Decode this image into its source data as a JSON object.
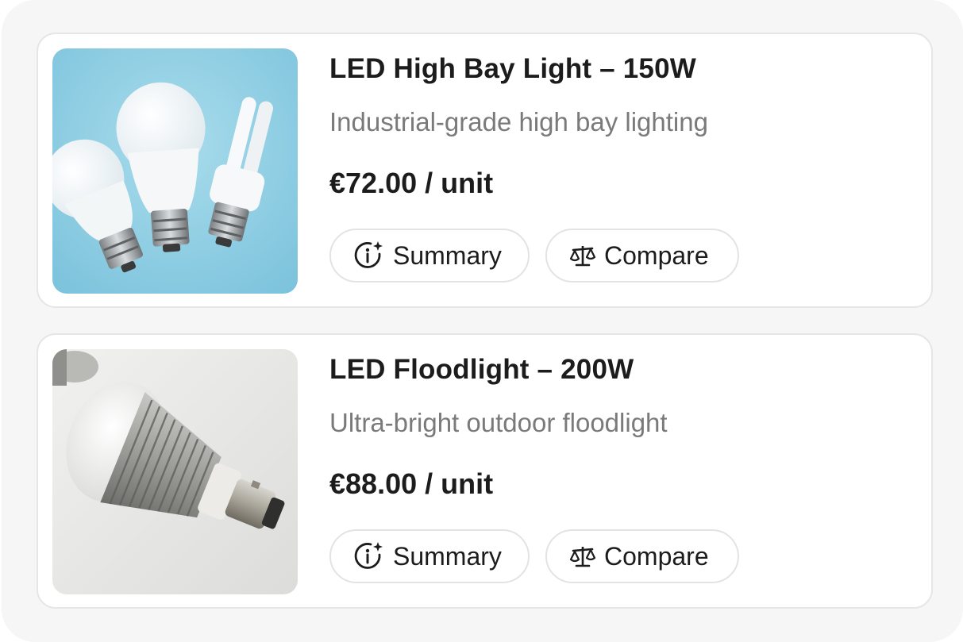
{
  "products": [
    {
      "title": "LED High Bay Light – 150W",
      "subtitle": "Industrial-grade high bay lighting",
      "price": "€72.00 / unit",
      "image": "bulbs-on-blue-photo",
      "summary_label": "Summary",
      "compare_label": "Compare"
    },
    {
      "title": "LED Floodlight – 200W",
      "subtitle": "Ultra-bright outdoor floodlight",
      "price": "€88.00 / unit",
      "image": "led-bulb-photo",
      "summary_label": "Summary",
      "compare_label": "Compare"
    }
  ],
  "icons": {
    "summary": "info-sparkle-icon",
    "compare": "scale-icon"
  },
  "colors": {
    "panel_bg": "#f6f6f6",
    "card_bg": "#ffffff",
    "title": "#1c1c1c",
    "subtitle": "#7a7a7a",
    "border": "#e3e3e3"
  }
}
